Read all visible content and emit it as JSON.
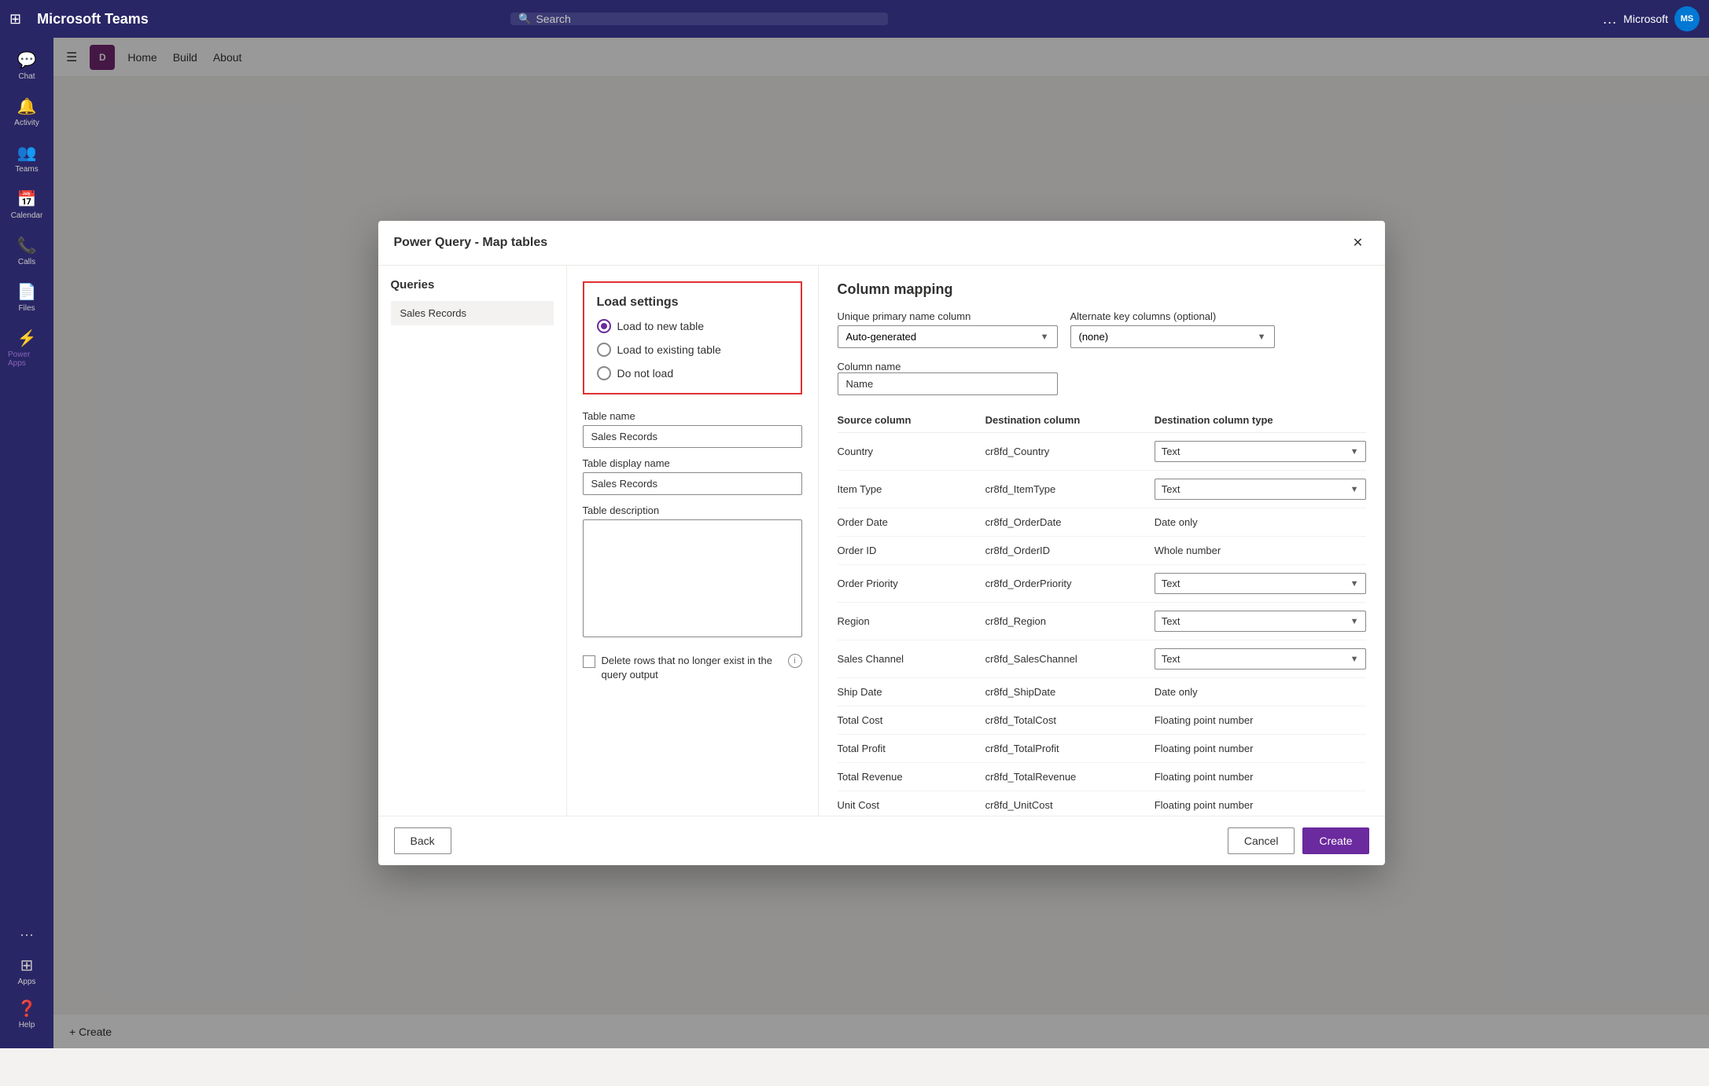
{
  "teams": {
    "app_name": "Microsoft Teams",
    "search_placeholder": "Search",
    "user_name": "Microsoft",
    "avatar_initials": "MS",
    "sidebar": [
      {
        "id": "chat",
        "label": "Chat",
        "icon": "💬"
      },
      {
        "id": "activity",
        "label": "Activity",
        "icon": "🔔"
      },
      {
        "id": "teams",
        "label": "Teams",
        "icon": "👥"
      },
      {
        "id": "calendar",
        "label": "Calendar",
        "icon": "📅"
      },
      {
        "id": "calls",
        "label": "Calls",
        "icon": "📞"
      },
      {
        "id": "files",
        "label": "Files",
        "icon": "📄"
      },
      {
        "id": "powerapps",
        "label": "Power Apps",
        "icon": "⚡",
        "active": true
      }
    ],
    "more_label": "..."
  },
  "powerapps_bar": {
    "icon_text": "D",
    "nav_items": [
      "Home",
      "Build",
      "About"
    ]
  },
  "dialog": {
    "title": "Power Query - Map tables",
    "close_label": "✕"
  },
  "queries": {
    "title": "Queries",
    "items": [
      {
        "name": "Sales Records"
      }
    ]
  },
  "load_settings": {
    "title": "Load settings",
    "options": [
      {
        "id": "new_table",
        "label": "Load to new table",
        "selected": true
      },
      {
        "id": "existing_table",
        "label": "Load to existing table",
        "selected": false
      },
      {
        "id": "do_not_load",
        "label": "Do not load",
        "selected": false
      }
    ],
    "table_name_label": "Table name",
    "table_name_value": "Sales Records",
    "table_display_name_label": "Table display name",
    "table_display_name_value": "Sales Records",
    "table_description_label": "Table description",
    "table_description_value": "",
    "delete_rows_label": "Delete rows that no longer exist in the query output"
  },
  "column_mapping": {
    "title": "Column mapping",
    "unique_primary_label": "Unique primary name column",
    "unique_primary_value": "Auto-generated",
    "alternate_key_label": "Alternate key columns (optional)",
    "alternate_key_value": "(none)",
    "column_name_label": "Column name",
    "column_name_value": "Name",
    "table_headers": [
      "Source column",
      "Destination column",
      "Destination column type"
    ],
    "rows": [
      {
        "source": "Country",
        "dest": "cr8fd_Country",
        "type": "Text",
        "type_dropdown": true
      },
      {
        "source": "Item Type",
        "dest": "cr8fd_ItemType",
        "type": "Text",
        "type_dropdown": true
      },
      {
        "source": "Order Date",
        "dest": "cr8fd_OrderDate",
        "type": "Date only",
        "type_dropdown": false
      },
      {
        "source": "Order ID",
        "dest": "cr8fd_OrderID",
        "type": "Whole number",
        "type_dropdown": false
      },
      {
        "source": "Order Priority",
        "dest": "cr8fd_OrderPriority",
        "type": "Text",
        "type_dropdown": true
      },
      {
        "source": "Region",
        "dest": "cr8fd_Region",
        "type": "Text",
        "type_dropdown": true
      },
      {
        "source": "Sales Channel",
        "dest": "cr8fd_SalesChannel",
        "type": "Text",
        "type_dropdown": true
      },
      {
        "source": "Ship Date",
        "dest": "cr8fd_ShipDate",
        "type": "Date only",
        "type_dropdown": false
      },
      {
        "source": "Total Cost",
        "dest": "cr8fd_TotalCost",
        "type": "Floating point number",
        "type_dropdown": false
      },
      {
        "source": "Total Profit",
        "dest": "cr8fd_TotalProfit",
        "type": "Floating point number",
        "type_dropdown": false
      },
      {
        "source": "Total Revenue",
        "dest": "cr8fd_TotalRevenue",
        "type": "Floating point number",
        "type_dropdown": false
      },
      {
        "source": "Unit Cost",
        "dest": "cr8fd_UnitCost",
        "type": "Floating point number",
        "type_dropdown": false
      }
    ]
  },
  "footer": {
    "back_label": "Back",
    "cancel_label": "Cancel",
    "create_label": "Create"
  },
  "bottom_bar": {
    "create_label": "+ Create"
  }
}
